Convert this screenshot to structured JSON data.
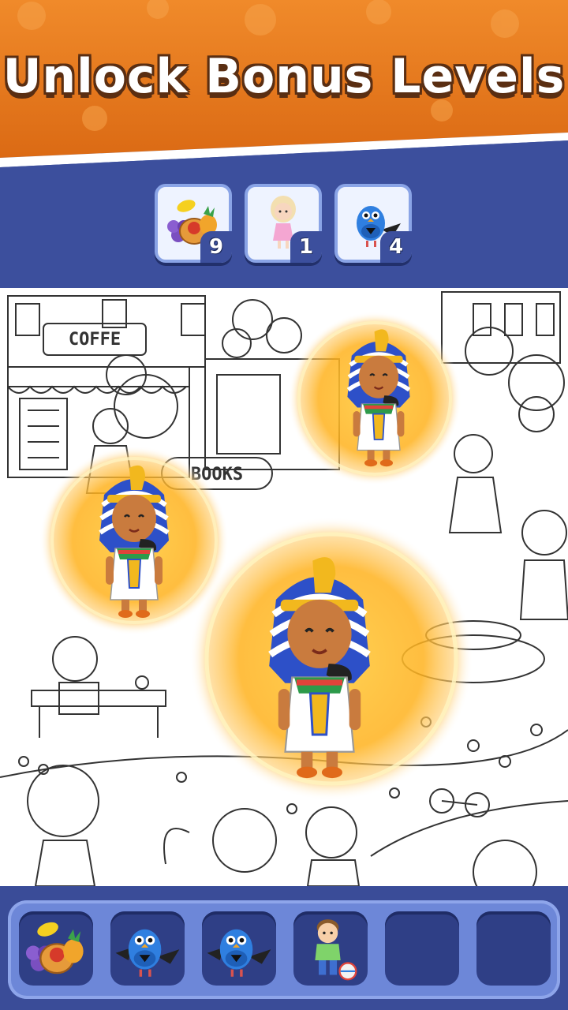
{
  "header": {
    "title": "Unlock Bonus Levels",
    "bg_color": "#e8781f"
  },
  "targets": [
    {
      "name": "fruit-basket",
      "icon": "fruit-basket-icon",
      "count": "9"
    },
    {
      "name": "girl",
      "icon": "girl-icon",
      "count": "1"
    },
    {
      "name": "bird",
      "icon": "bird-icon",
      "count": "4"
    }
  ],
  "scene": {
    "signs": {
      "coffee": "COFFE",
      "books": "BOOKS"
    },
    "pharaohs": [
      {
        "label": "pharaoh-top-right"
      },
      {
        "label": "pharaoh-left"
      },
      {
        "label": "pharaoh-center"
      }
    ]
  },
  "inventory": {
    "slots": [
      {
        "item": "fruit-basket-icon"
      },
      {
        "item": "bird-icon"
      },
      {
        "item": "bird-icon"
      },
      {
        "item": "boy-with-ball-icon"
      },
      {
        "item": "empty"
      },
      {
        "item": "empty"
      }
    ]
  },
  "colors": {
    "accent_orange": "#e8781f",
    "panel_blue": "#3c4f9d",
    "tray_blue": "#6d87d8",
    "glow": "#ffb21e"
  }
}
